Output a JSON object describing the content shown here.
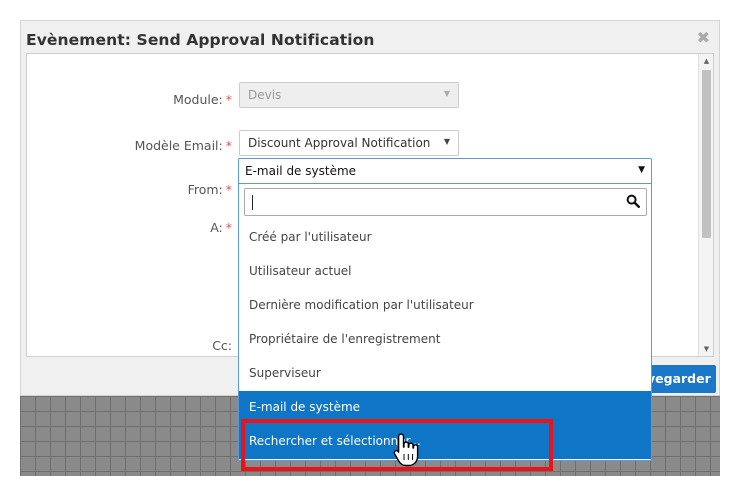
{
  "dialog": {
    "title": "Evènement: Send Approval Notification",
    "close_glyph": "✖"
  },
  "form": {
    "module_label": "Module:",
    "module_value": "Devis",
    "template_label": "Modèle Email:",
    "template_value": "Discount Approval Notification",
    "from_label": "From:",
    "from_value": "E-mail de système",
    "to_label": "A:",
    "cc_label": "Cc:",
    "required_mark": "*"
  },
  "dropdown": {
    "search_value": "",
    "options": [
      "Créé par l'utilisateur",
      "Utilisateur actuel",
      "Dernière modification par l'utilisateur",
      "Propriétaire de l'enregistrement",
      "Superviseur",
      "E-mail de système",
      "Rechercher et sélectionner..."
    ],
    "selected_option": "E-mail de système",
    "highlighted_option": "Rechercher et sélectionner..."
  },
  "footer": {
    "save_label": "vegarder"
  },
  "colors": {
    "accent": "#0f75c7",
    "required": "#d9534f",
    "highlight_border": "#e8141a"
  },
  "icons": {
    "close": "close-icon",
    "search": "search-icon",
    "dropdown": "chevron-down-icon",
    "cursor": "hand-pointer-icon"
  }
}
